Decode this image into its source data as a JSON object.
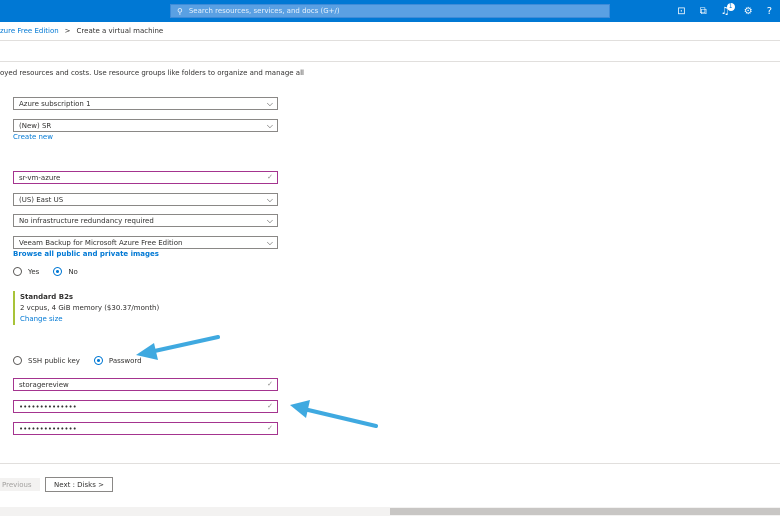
{
  "topbar": {
    "search_placeholder": "Search resources, services, and docs (G+/)",
    "notification_count": "1"
  },
  "breadcrumb": {
    "parent": "zure Free Edition",
    "separator": ">",
    "current": "Create a virtual machine"
  },
  "description": "oyed resources and costs. Use resource groups like folders to organize and manage all",
  "form": {
    "subscription": "Azure subscription 1",
    "resource_group": "(New) SR",
    "create_new": "Create new",
    "vm_name": "sr-vm-azure",
    "region": "(US) East US",
    "availability": "No infrastructure redundancy required",
    "image": "Veeam Backup for Microsoft Azure Free Edition",
    "browse_images": "Browse all public and private images",
    "spot": {
      "yes": "Yes",
      "no": "No",
      "selected": "No"
    },
    "size": {
      "name": "Standard B2s",
      "spec": "2 vcpus, 4 GiB memory ($30.37/month)",
      "change": "Change size"
    },
    "auth": {
      "ssh": "SSH public key",
      "password": "Password",
      "selected": "Password"
    },
    "username": "storagereview",
    "password_value": "••••••••••••••",
    "confirm_password_value": "••••••••••••••"
  },
  "footer": {
    "previous": "Previous",
    "next": "Next : Disks >"
  },
  "colors": {
    "accent": "#0078d4",
    "valid_border": "#a4348f",
    "annotation_arrow": "#3fa9e0"
  }
}
